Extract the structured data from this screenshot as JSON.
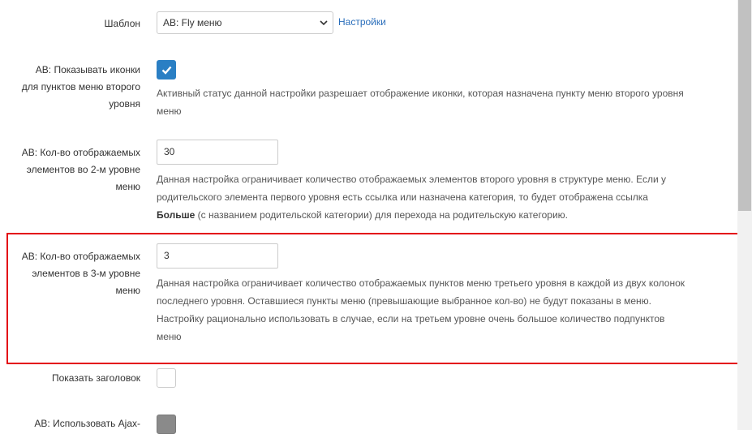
{
  "template_row": {
    "label": "Шаблон",
    "value": "AB: Fly меню",
    "settings_link": "Настройки"
  },
  "show_icons_row": {
    "label_lines": [
      "AB: Показывать иконки",
      "для пунктов меню второго",
      "уровня"
    ],
    "checked": true,
    "help_lines": [
      "Активный статус данной настройки разрешает отображение иконки, которая назначена пункту меню второго уровня",
      "меню"
    ]
  },
  "level2_row": {
    "label_lines": [
      "AB: Кол-во отображаемых",
      "элементов во 2-м уровне",
      "меню"
    ],
    "value": "30",
    "help_line1": "Данная настройка ограничивает количество отображаемых элементов второго уровня в структуре меню. Если у",
    "help_line2": "родительского элемента первого уровня есть ссылка или назначена категория, то будет отображена ссылка",
    "help_bold": "Больше",
    "help_line3_rest": " (с названием родительской категории) для перехода на родительскую категорию."
  },
  "level3_row": {
    "label_lines": [
      "AB: Кол-во отображаемых",
      "элементов в 3-м уровне",
      "меню"
    ],
    "value": "3",
    "help_lines": [
      "Данная настройка ограничивает количество отображаемых пунктов меню третьего уровня в каждой из двух колонок",
      "последнего уровня. Оставшиеся пункты меню (превышающие выбранное кол-во) не будут показаны в меню.",
      "Настройку рационально использовать в случае, если на третьем уровне очень большое количество подпунктов",
      "меню"
    ]
  },
  "show_title_row": {
    "label": "Показать заголовок",
    "checked": false
  },
  "ajax_row": {
    "label": "AB: Использовать Ajax-",
    "disabled": true
  },
  "colors": {
    "highlight": "#e3000f",
    "checkbox_checked": "#2a7fc4",
    "link": "#2a6ebb"
  }
}
